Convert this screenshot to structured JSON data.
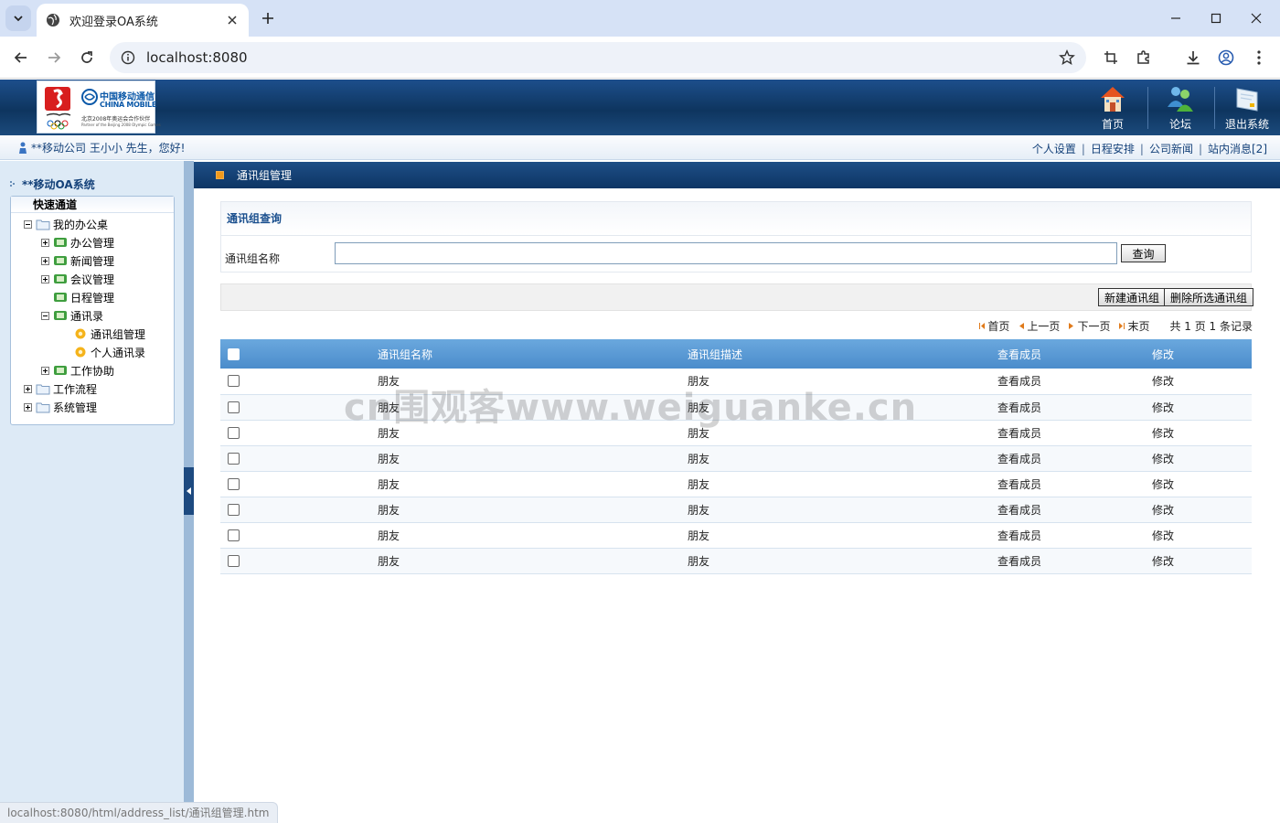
{
  "browser": {
    "tab_title": "欢迎登录OA系统",
    "url": "localhost:8080",
    "status_url": "localhost:8080/html/address_list/通讯组管理.htm"
  },
  "header": {
    "logo": {
      "cn_name": "中国移动通信",
      "en_name": "CHINA MOBILE",
      "partner_cn": "北京2008年奥运会合作伙伴",
      "partner_en": "Partner of the Beijing 2008 Olympic Games"
    },
    "buttons": [
      {
        "label": "首页",
        "icon": "home-icon"
      },
      {
        "label": "论坛",
        "icon": "forum-icon"
      },
      {
        "label": "退出系统",
        "icon": "logout-icon"
      }
    ]
  },
  "welcome": {
    "text": "**移动公司 王小小 先生，您好!",
    "links": [
      "个人设置",
      "日程安排",
      "公司新闻",
      "站内消息[2]"
    ]
  },
  "sidebar": {
    "system_title": "**移动OA系统",
    "quick_channel": "快速通道",
    "tree": {
      "desk": "我的办公桌",
      "office": "办公管理",
      "news": "新闻管理",
      "meeting": "会议管理",
      "schedule": "日程管理",
      "address": "通讯录",
      "group_mgmt": "通讯组管理",
      "personal": "个人通讯录",
      "work_assist": "工作协助",
      "workflow": "工作流程",
      "sysadmin": "系统管理"
    }
  },
  "main": {
    "section_title": "通讯组管理",
    "query": {
      "title": "通讯组查询",
      "label": "通讯组名称",
      "input_value": "",
      "button": "查询"
    },
    "actions": {
      "new": "新建通讯组",
      "delete": "删除所选通讯组"
    },
    "pager": {
      "first": "首页",
      "prev": "上一页",
      "next": "下一页",
      "last": "末页",
      "summary": "共 1 页 1 条记录"
    },
    "table": {
      "columns": [
        "通讯组名称",
        "通讯组描述",
        "查看成员",
        "修改"
      ],
      "rows": [
        {
          "name": "朋友",
          "desc": "朋友",
          "view": "查看成员",
          "edit": "修改"
        },
        {
          "name": "朋友",
          "desc": "朋友",
          "view": "查看成员",
          "edit": "修改"
        },
        {
          "name": "朋友",
          "desc": "朋友",
          "view": "查看成员",
          "edit": "修改"
        },
        {
          "name": "朋友",
          "desc": "朋友",
          "view": "查看成员",
          "edit": "修改"
        },
        {
          "name": "朋友",
          "desc": "朋友",
          "view": "查看成员",
          "edit": "修改"
        },
        {
          "name": "朋友",
          "desc": "朋友",
          "view": "查看成员",
          "edit": "修改"
        },
        {
          "name": "朋友",
          "desc": "朋友",
          "view": "查看成员",
          "edit": "修改"
        },
        {
          "name": "朋友",
          "desc": "朋友",
          "view": "查看成员",
          "edit": "修改"
        }
      ]
    }
  },
  "watermark": "cn围观客www.weiguanke.cn",
  "colors": {
    "header_blue": "#0e355f",
    "table_header": "#5b9bd5",
    "link_blue": "#1a5fb0",
    "accent_orange": "#f39a1b"
  }
}
